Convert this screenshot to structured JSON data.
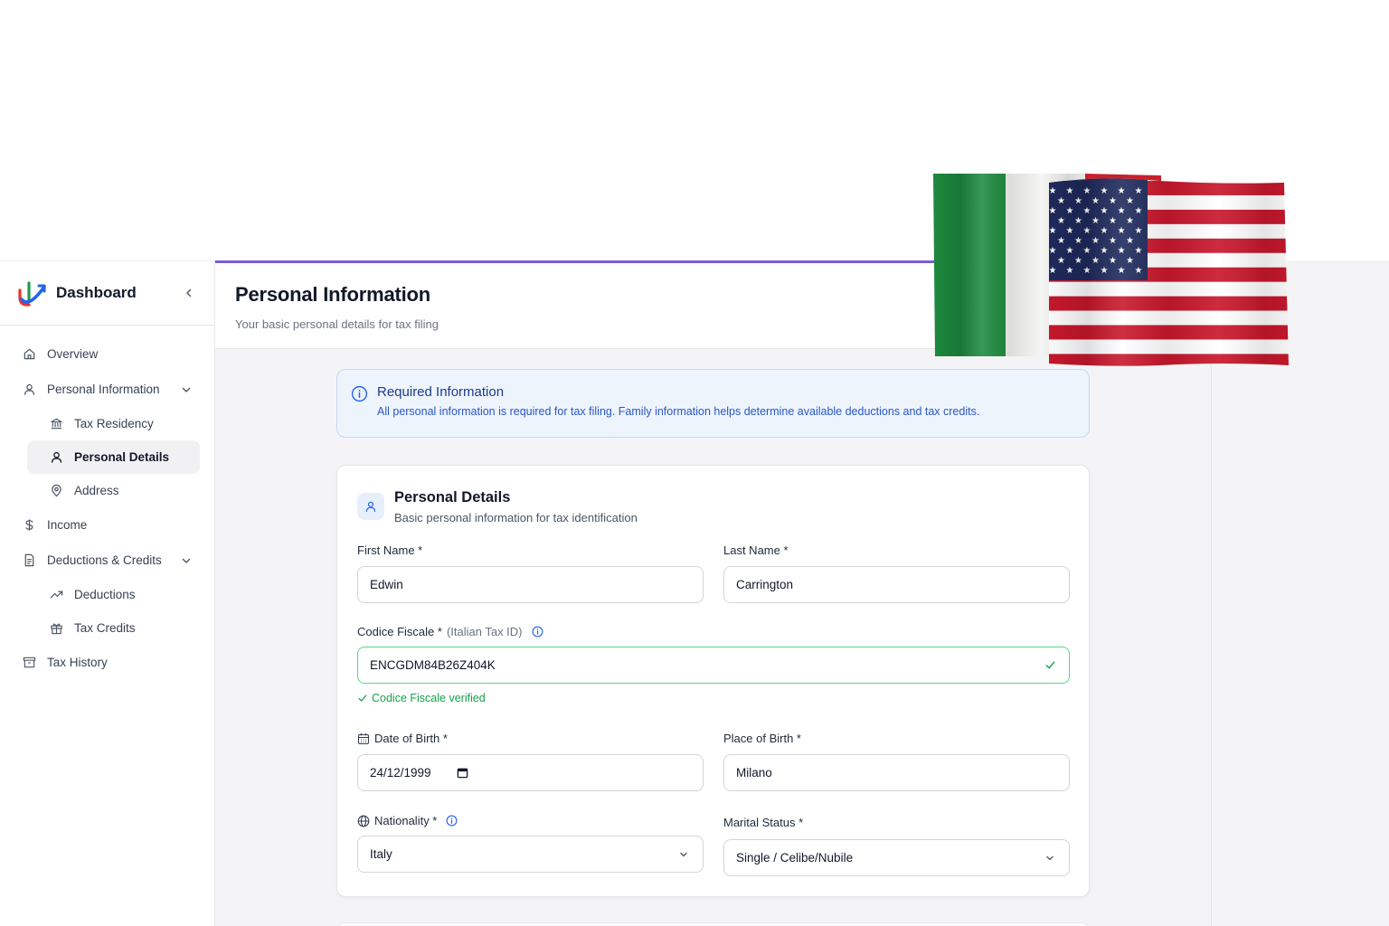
{
  "sidebar": {
    "title": "Dashboard",
    "items": [
      {
        "label": "Overview",
        "icon": "home-icon"
      },
      {
        "label": "Personal Information",
        "icon": "user-icon"
      },
      {
        "label": "Tax Residency",
        "icon": "bank-icon"
      },
      {
        "label": "Personal Details",
        "icon": "user-icon"
      },
      {
        "label": "Address",
        "icon": "map-pin-icon"
      },
      {
        "label": "Income",
        "icon": "dollar-icon"
      },
      {
        "label": "Deductions & Credits",
        "icon": "document-icon"
      },
      {
        "label": "Deductions",
        "icon": "trending-icon"
      },
      {
        "label": "Tax Credits",
        "icon": "gift-icon"
      },
      {
        "label": "Tax History",
        "icon": "archive-icon"
      }
    ]
  },
  "header": {
    "title": "Personal Information",
    "subtitle": "Your basic personal details for tax filing"
  },
  "info_banner": {
    "title": "Required Information",
    "text": "All personal information is required for tax filing. Family information helps determine available deductions and tax credits."
  },
  "card": {
    "title": "Personal Details",
    "subtitle": "Basic personal information for tax identification",
    "first_name": {
      "label": "First Name *",
      "value": "Edwin"
    },
    "last_name": {
      "label": "Last Name *",
      "value": "Carrington"
    },
    "codice_fiscale": {
      "label": "Codice Fiscale *",
      "hint": "(Italian Tax ID)",
      "value": "ENCGDM84B26Z404K",
      "status": "Codice Fiscale verified"
    },
    "date_of_birth": {
      "label": "Date of Birth *",
      "value": "24/12/1999"
    },
    "place_of_birth": {
      "label": "Place of Birth *",
      "value": "Milano"
    },
    "nationality": {
      "label": "Nationality *",
      "value": "Italy"
    },
    "marital_status": {
      "label": "Marital Status *",
      "value": "Single / Celibe/Nubile"
    }
  },
  "colors": {
    "accent": "#7c5cdb",
    "info_blue": "#2563eb",
    "success": "#16a34a"
  }
}
